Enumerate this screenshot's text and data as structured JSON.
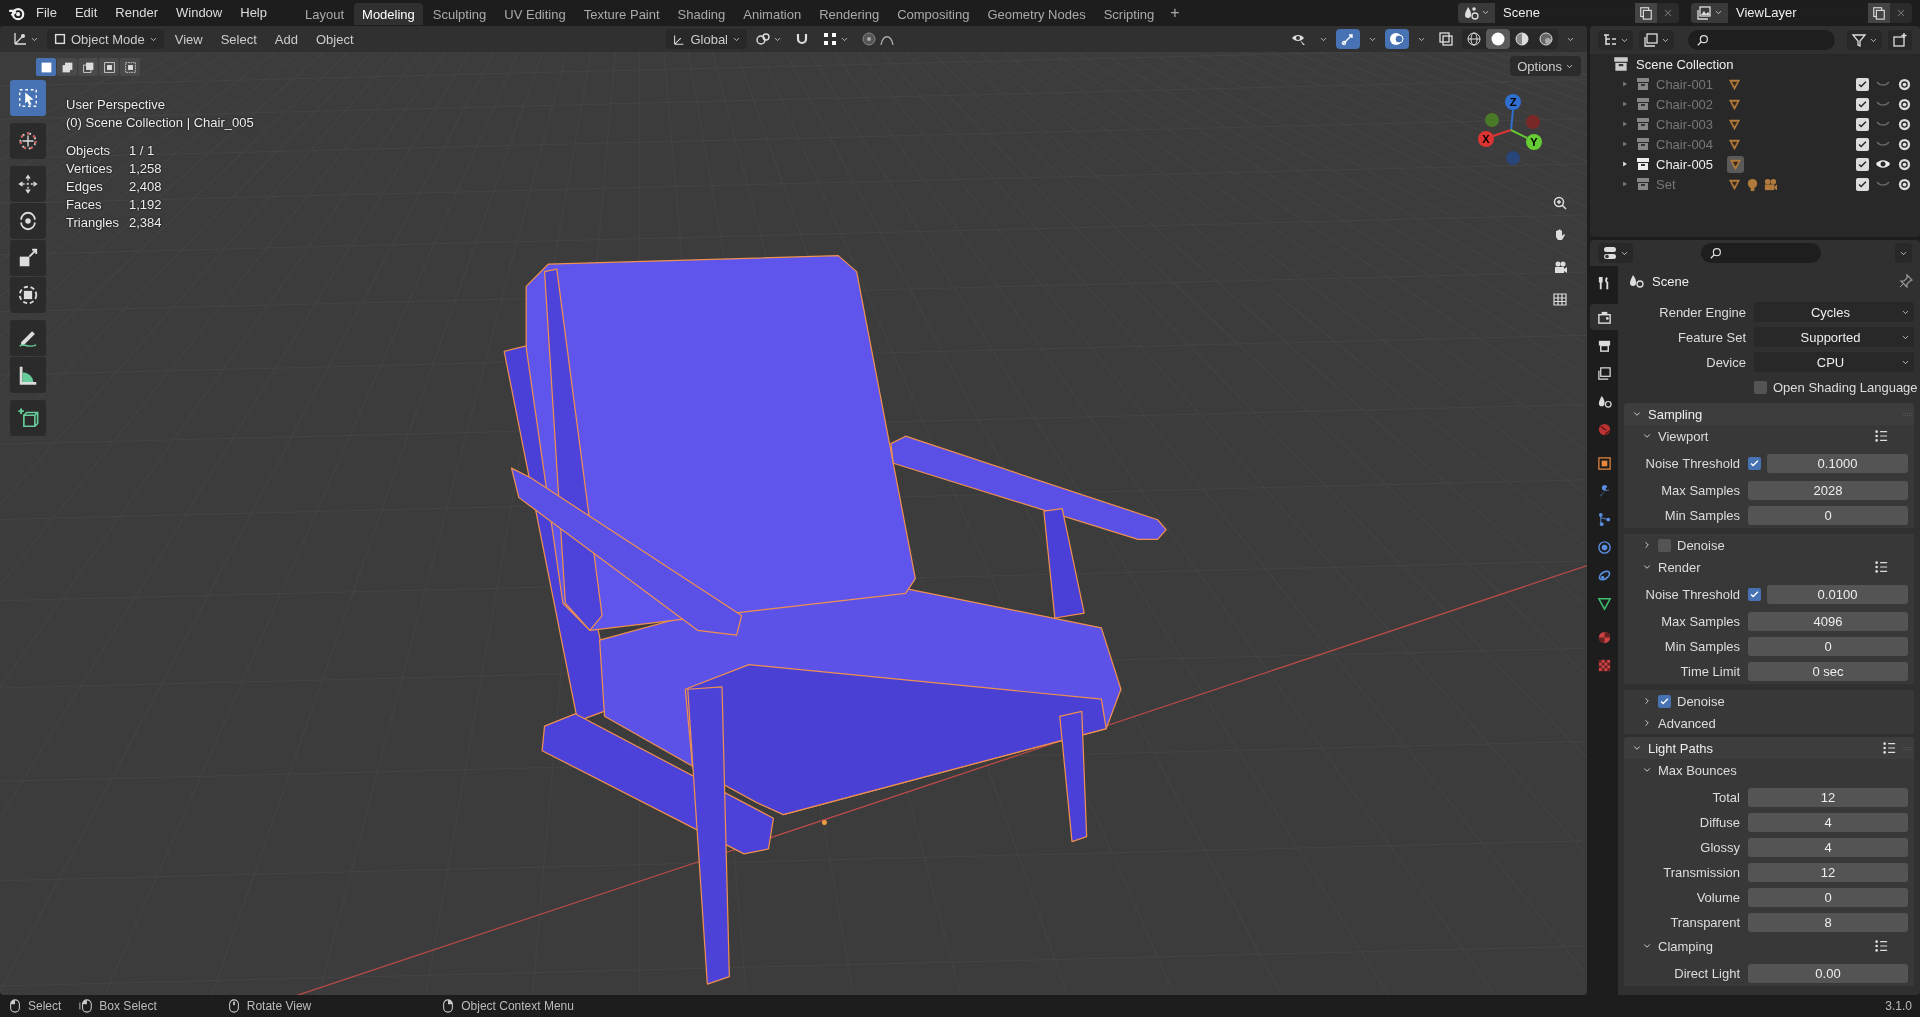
{
  "menu": [
    "File",
    "Edit",
    "Render",
    "Window",
    "Help"
  ],
  "workspaces": [
    {
      "label": "Layout",
      "selected": false
    },
    {
      "label": "Modeling",
      "selected": true
    },
    {
      "label": "Sculpting",
      "selected": false
    },
    {
      "label": "UV Editing",
      "selected": false
    },
    {
      "label": "Texture Paint",
      "selected": false
    },
    {
      "label": "Shading",
      "selected": false
    },
    {
      "label": "Animation",
      "selected": false
    },
    {
      "label": "Rendering",
      "selected": false
    },
    {
      "label": "Compositing",
      "selected": false
    },
    {
      "label": "Geometry Nodes",
      "selected": false
    },
    {
      "label": "Scripting",
      "selected": false
    }
  ],
  "add_workspace": "+",
  "scene": "Scene",
  "view_layer": "ViewLayer",
  "viewport_header": {
    "mode": "Object Mode",
    "menus": [
      "View",
      "Select",
      "Add",
      "Object"
    ],
    "orientation": "Global",
    "options": "Options",
    "toggles": [
      {
        "kind": "visibility",
        "on": false
      },
      {
        "kind": "gizmo",
        "on": true
      },
      {
        "kind": "overlay",
        "on": true
      },
      {
        "kind": "xray",
        "on": false
      }
    ],
    "shading": [
      {
        "kind": "wireframe",
        "selected": false
      },
      {
        "kind": "solid",
        "selected": true
      },
      {
        "kind": "material",
        "selected": false
      },
      {
        "kind": "rendered",
        "selected": false
      }
    ],
    "select_modes": [
      {
        "kind": "set",
        "selected": true
      },
      {
        "kind": "extend",
        "selected": false
      },
      {
        "kind": "subtract",
        "selected": false
      },
      {
        "kind": "invert",
        "selected": false
      },
      {
        "kind": "intersect",
        "selected": false
      }
    ]
  },
  "tools": [
    {
      "kind": "select",
      "selected": true
    },
    {
      "kind": "cursor",
      "selected": false
    },
    {
      "kind": "move",
      "selected": false
    },
    {
      "kind": "rotate",
      "selected": false
    },
    {
      "kind": "scale",
      "selected": false
    },
    {
      "kind": "transform",
      "selected": false
    },
    {
      "kind": "annotate",
      "selected": false
    },
    {
      "kind": "measure",
      "selected": false
    },
    {
      "kind": "add-cube",
      "selected": false
    }
  ],
  "overlay": {
    "title": "User Perspective",
    "collection": "(0) Scene Collection | Chair_005",
    "stats": [
      {
        "label": "Objects",
        "value": "1 / 1"
      },
      {
        "label": "Vertices",
        "value": "1,258"
      },
      {
        "label": "Edges",
        "value": "2,408"
      },
      {
        "label": "Faces",
        "value": "1,192"
      },
      {
        "label": "Triangles",
        "value": "2,384"
      }
    ]
  },
  "gizmo": {
    "x": "X",
    "y": "Y",
    "z": "Z"
  },
  "outliner": {
    "root": "Scene Collection",
    "items": [
      {
        "name": "Chair-001",
        "contents": [
          {
            "kind": "mesh"
          }
        ],
        "selected": false,
        "checked": true,
        "visible": false
      },
      {
        "name": "Chair-002",
        "contents": [
          {
            "kind": "mesh"
          }
        ],
        "selected": false,
        "checked": true,
        "visible": false
      },
      {
        "name": "Chair-003",
        "contents": [
          {
            "kind": "mesh"
          }
        ],
        "selected": false,
        "checked": true,
        "visible": false
      },
      {
        "name": "Chair-004",
        "contents": [
          {
            "kind": "mesh"
          }
        ],
        "selected": false,
        "checked": true,
        "visible": false
      },
      {
        "name": "Chair-005",
        "contents": [
          {
            "kind": "mesh"
          }
        ],
        "selected": true,
        "checked": true,
        "visible": true
      },
      {
        "name": "Set",
        "contents": [
          {
            "kind": "mesh"
          },
          {
            "kind": "light"
          },
          {
            "kind": "camera"
          }
        ],
        "selected": false,
        "checked": true,
        "visible": false
      }
    ]
  },
  "properties": {
    "tabs": [
      {
        "kind": "tool",
        "selected": false
      },
      {
        "kind": "render",
        "selected": true
      },
      {
        "kind": "output",
        "selected": false
      },
      {
        "kind": "view-layer",
        "selected": false
      },
      {
        "kind": "scene",
        "selected": false
      },
      {
        "kind": "world",
        "selected": false
      },
      {
        "kind": "object",
        "selected": false
      },
      {
        "kind": "modifier",
        "selected": false
      },
      {
        "kind": "particles",
        "selected": false
      },
      {
        "kind": "physics",
        "selected": false
      },
      {
        "kind": "constraints",
        "selected": false
      },
      {
        "kind": "data",
        "selected": false
      },
      {
        "kind": "material",
        "selected": false
      },
      {
        "kind": "texture",
        "selected": false
      }
    ],
    "context": "Scene",
    "fields": [
      {
        "label": "Render Engine",
        "value": "Cycles"
      },
      {
        "label": "Feature Set",
        "value": "Supported"
      },
      {
        "label": "Device",
        "value": "CPU"
      }
    ],
    "osl": {
      "label": "Open Shading Language",
      "checked": false
    },
    "rows": [
      {
        "kind": "panel",
        "label": "Sampling",
        "expanded": true
      },
      {
        "kind": "subpanel",
        "label": "Viewport",
        "expanded": true
      },
      {
        "kind": "check_field",
        "label": "Noise Threshold",
        "checked": true,
        "value": "0.1000"
      },
      {
        "kind": "field",
        "label": "Max Samples",
        "value": "2028"
      },
      {
        "kind": "field",
        "label": "Min Samples",
        "value": "0"
      },
      {
        "kind": "check_subpanel",
        "label": "Denoise",
        "expanded": false,
        "checked": false
      },
      {
        "kind": "subpanel",
        "label": "Render",
        "expanded": true
      },
      {
        "kind": "check_field",
        "label": "Noise Threshold",
        "checked": true,
        "value": "0.0100"
      },
      {
        "kind": "field",
        "label": "Max Samples",
        "value": "4096"
      },
      {
        "kind": "field",
        "label": "Min Samples",
        "value": "0"
      },
      {
        "kind": "field",
        "label": "Time Limit",
        "value": "0 sec"
      },
      {
        "kind": "check_subpanel",
        "label": "Denoise",
        "expanded": false,
        "checked": true
      },
      {
        "kind": "subpanel",
        "label": "Advanced",
        "expanded": false
      },
      {
        "kind": "panel",
        "label": "Light Paths",
        "expanded": true
      },
      {
        "kind": "subpanel",
        "label": "Max Bounces",
        "expanded": true
      },
      {
        "kind": "field",
        "label": "Total",
        "value": "12"
      },
      {
        "kind": "field",
        "label": "Diffuse",
        "value": "4"
      },
      {
        "kind": "field",
        "label": "Glossy",
        "value": "4"
      },
      {
        "kind": "field",
        "label": "Transmission",
        "value": "12"
      },
      {
        "kind": "field",
        "label": "Volume",
        "value": "0"
      },
      {
        "kind": "field",
        "label": "Transparent",
        "value": "8"
      },
      {
        "kind": "subpanel",
        "label": "Clamping",
        "expanded": true
      },
      {
        "kind": "field",
        "label": "Direct Light",
        "value": "0.00"
      }
    ]
  },
  "status_bar": {
    "hints": [
      {
        "kind": "left-mouse",
        "label": "Select"
      },
      {
        "kind": "drag",
        "label": "Box Select"
      },
      {
        "kind": "middle-mouse",
        "label": "Rotate View"
      },
      {
        "kind": "right-mouse",
        "label": "Object Context Menu"
      }
    ],
    "version": "3.1.0"
  }
}
